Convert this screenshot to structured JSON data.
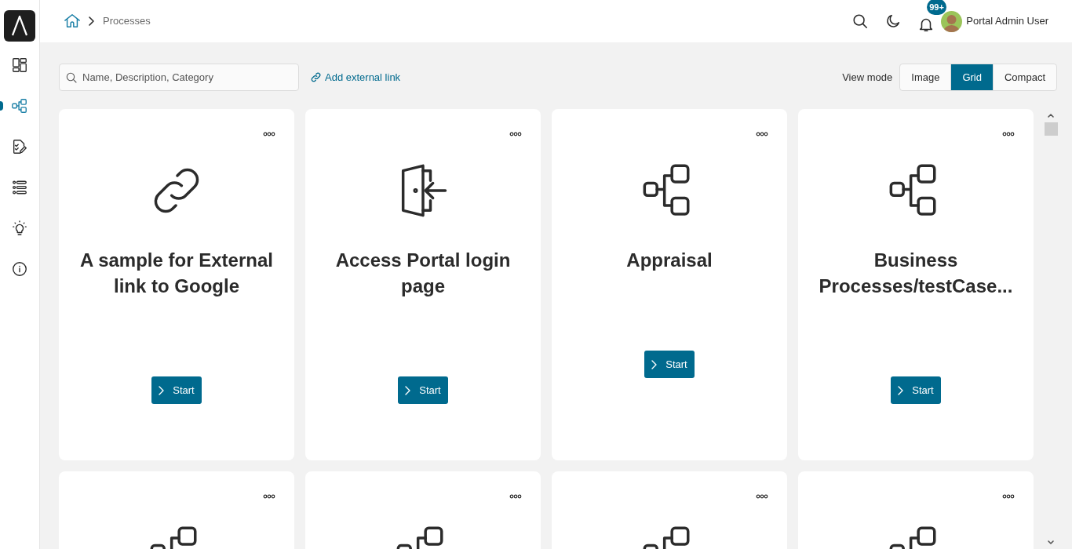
{
  "sidebar": {
    "items": [
      {
        "kind": "dashboard",
        "selected": false
      },
      {
        "kind": "process",
        "selected": true
      },
      {
        "kind": "tasks",
        "selected": false
      },
      {
        "kind": "list",
        "selected": false
      },
      {
        "kind": "idea",
        "selected": false
      },
      {
        "kind": "info",
        "selected": false
      }
    ]
  },
  "breadcrumb": {
    "current": "Processes"
  },
  "header": {
    "notification_badge": "99+",
    "user_name": "Portal Admin User"
  },
  "toolbar": {
    "search": {
      "placeholder": "Name, Description, Category"
    },
    "add_link": "Add external link",
    "view_mode_label": "View mode",
    "view_modes": [
      {
        "label": "Image",
        "selected": false
      },
      {
        "label": "Grid",
        "selected": true
      },
      {
        "label": "Compact",
        "selected": false
      }
    ]
  },
  "cards": [
    {
      "kind": "link",
      "title": "A sample for External link to Google",
      "button": "Start"
    },
    {
      "kind": "door",
      "title": "Access Portal login page",
      "button": "Start"
    },
    {
      "kind": "process",
      "title": "Appraisal",
      "button": "Start"
    },
    {
      "kind": "process",
      "title": "Business Processes/testCase...",
      "button": "Start"
    },
    {
      "kind": "process"
    },
    {
      "kind": "process"
    },
    {
      "kind": "process"
    },
    {
      "kind": "process"
    }
  ]
}
